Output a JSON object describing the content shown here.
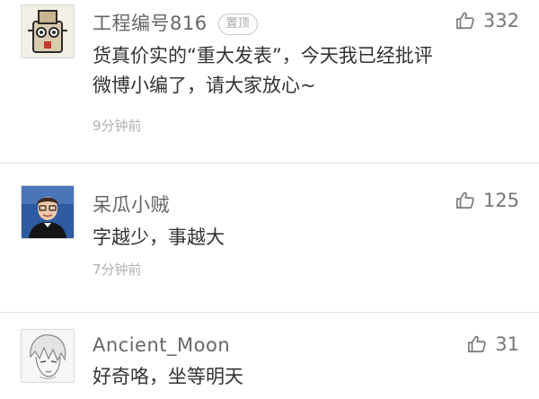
{
  "comments": [
    {
      "username": "工程编号816",
      "badge": "置顶",
      "likes": "332",
      "text_lines": [
        "货真价实的“重大发表”，今天我已经批评",
        "微博小编了，请大家放心~"
      ],
      "time": "9分钟前"
    },
    {
      "username": "呆瓜小贼",
      "likes": "125",
      "text_lines": [
        "字越少，事越大"
      ],
      "time": "7分钟前"
    },
    {
      "username": "Ancient_Moon",
      "likes": "31",
      "text_lines": [
        "好奇咯，坐等明天"
      ]
    }
  ]
}
